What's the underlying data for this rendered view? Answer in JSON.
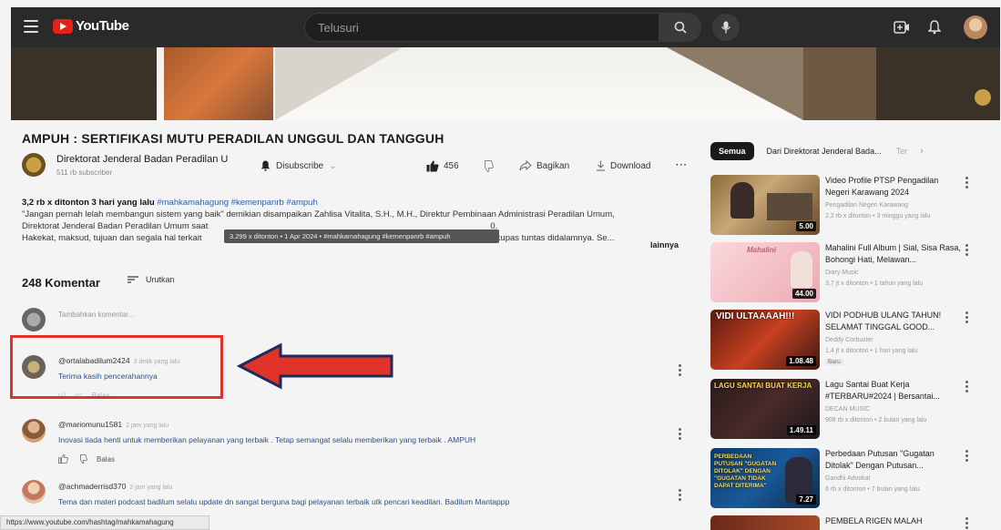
{
  "header": {
    "logo_text": "YouTube",
    "search_placeholder": "Telusuri"
  },
  "video": {
    "title": "AMPUH : SERTIFIKASI MUTU PERADILAN UNGGUL DAN TANGGUH",
    "channel": "Direktorat Jenderal Badan Peradilan U",
    "subscribers": "511 rb subscriber",
    "subscribe_label": "Disubscribe",
    "likes": "456",
    "share_label": "Bagikan",
    "download_label": "Download"
  },
  "description": {
    "meta": "3,2 rb x ditonton  3 hari yang lalu",
    "tags": "#mahkamahagung #kemenpanrb #ampuh",
    "line1": "\"Jangan pernah lelah membangun sistem yang baik\" demikian disampaikan Zahlisa Vitalita, S.H., M.H., Direktur Pembinaan Administrasi Peradilan Umum,",
    "line2": "Direktorat Jenderal Badan Peradilan Umum saat",
    "line2_end": "0.",
    "line3": "Hakekat, maksud, tujuan dan segala hal terkait",
    "line3_end": "mum dikupas tuntas didalamnya. Se...",
    "more": "lainnya",
    "tooltip": "3.299 x ditonton • 1 Apr 2024 • #mahkamahagung #kemenpanrb #ampuh"
  },
  "comments": {
    "count_label": "248 Komentar",
    "sort_label": "Urutkan",
    "add_placeholder": "Tambahkan komentar...",
    "reply_label": "Balas",
    "items": [
      {
        "user": "@ortalabadilum2424",
        "time": "3 detik yang lalu",
        "text": "Terima kasih pencerahannya"
      },
      {
        "user": "@mariomunu1581",
        "time": "2 jam yang lalu",
        "text": "Inovasi tiada henti untuk memberikan pelayanan yang terbaik . Tetap semangat selalu memberikan yang terbaik . AMPUH"
      },
      {
        "user": "@achmaderrisd370",
        "time": "2 jam yang lalu",
        "text": "Tema dan materi podcast badilum selalu update dn sangat berguna bagi pelayanan terbaik utk pencari keadilan.  Badilum Mantappp"
      }
    ]
  },
  "status_url": "https://www.youtube.com/hashtag/mahkamahagung",
  "sidebar": {
    "chips": [
      "Semua",
      "Dari Direktorat Jenderal Bada...",
      "Ter"
    ],
    "recommendations": [
      {
        "title": "Video Profile PTSP Pengadilan Negeri Karawang 2024",
        "channel": "Pengadilan Negeri Karawang",
        "meta": "2,2 rb x ditonton • 3 minggu yang lalu",
        "duration": "5.00",
        "badge": ""
      },
      {
        "title": "Mahalini Full Album | Sial, Sisa Rasa, Bohongi Hati, Melawan...",
        "channel": "Diary Music",
        "meta": "3,7 jt x ditonton • 1 tahun yang lalu",
        "duration": "44.00",
        "badge": "",
        "thumb_text": "Mahalini"
      },
      {
        "title": "VIDI PODHUB ULANG TAHUN! SELAMAT TINGGAL GOOD...",
        "channel": "Deddy Corbuzier",
        "meta": "1,4 jt x ditonton • 1 hari yang lalu",
        "duration": "1.08.48",
        "badge": "Baru",
        "thumb_text": "VIDI ULTAAAAH!!!"
      },
      {
        "title": "Lagu Santai Buat Kerja #TERBARU#2024 | Bersantai...",
        "channel": "DECAN MUSIC",
        "meta": "908 rb x ditonton • 2 bulan yang lalu",
        "duration": "1.49.11",
        "badge": "",
        "thumb_text": "LAGU SANTAI BUAT KERJA"
      },
      {
        "title": "Perbedaan Putusan \"Gugatan Ditolak\" Dengan Putusan...",
        "channel": "Gandhi Advokat",
        "meta": "6 rb x ditonton • 7 bulan yang lalu",
        "duration": "7.27",
        "badge": "",
        "thumb_text": "PERBEDAAN PUTUSAN \"GUGATAN DITOLAK\" DENGAN \"GUGATAN TIDAK DAPAT DITERIMA\""
      },
      {
        "title": "PEMBELA RIGEN MALAH",
        "channel": "",
        "meta": "",
        "duration": "",
        "badge": ""
      }
    ]
  }
}
